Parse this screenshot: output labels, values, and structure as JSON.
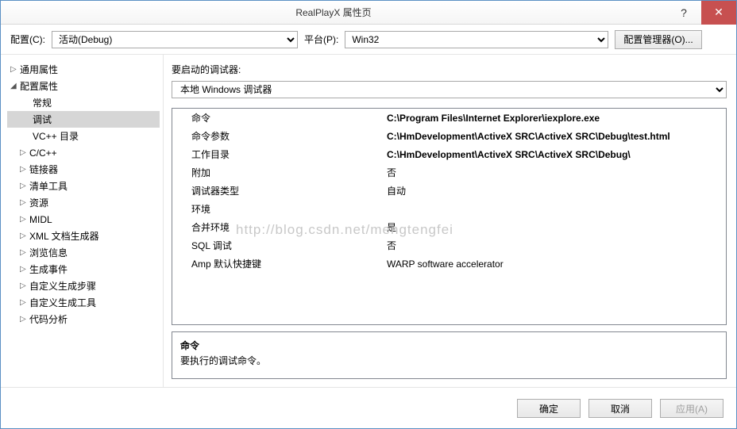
{
  "window": {
    "title": "RealPlayX 属性页"
  },
  "toprow": {
    "config_label": "配置(C):",
    "config_value": "活动(Debug)",
    "platform_label": "平台(P):",
    "platform_value": "Win32",
    "manager_button": "配置管理器(O)..."
  },
  "tree": {
    "root1": "通用属性",
    "root2": "配置属性",
    "items": {
      "general": "常规",
      "debug": "调试",
      "vcdir": "VC++ 目录",
      "cc": "C/C++",
      "linker": "链接器",
      "manifest": "清单工具",
      "resource": "资源",
      "midl": "MIDL",
      "xml": "XML 文档生成器",
      "browse": "浏览信息",
      "build": "生成事件",
      "custom_step": "自定义生成步骤",
      "custom_tool": "自定义生成工具",
      "analysis": "代码分析"
    }
  },
  "panel": {
    "label": "要启动的调试器:",
    "debugger_value": "本地 Windows 调试器"
  },
  "props": {
    "command": {
      "k": "命令",
      "v": "C:\\Program Files\\Internet Explorer\\iexplore.exe"
    },
    "args": {
      "k": "命令参数",
      "v": "C:\\HmDevelopment\\ActiveX SRC\\ActiveX SRC\\Debug\\test.html"
    },
    "workdir": {
      "k": "工作目录",
      "v": "C:\\HmDevelopment\\ActiveX SRC\\ActiveX SRC\\Debug\\"
    },
    "attach": {
      "k": "附加",
      "v": "否"
    },
    "dbgtype": {
      "k": "调试器类型",
      "v": "自动"
    },
    "env": {
      "k": "环境",
      "v": ""
    },
    "mergeenv": {
      "k": "合并环境",
      "v": "是"
    },
    "sql": {
      "k": "SQL 调试",
      "v": "否"
    },
    "amp": {
      "k": "Amp 默认快捷键",
      "v": "WARP software accelerator"
    }
  },
  "help": {
    "title": "命令",
    "desc": "要执行的调试命令。"
  },
  "buttons": {
    "ok": "确定",
    "cancel": "取消",
    "apply": "应用(A)"
  },
  "watermark": "http://blog.csdn.net/mengtengfei"
}
